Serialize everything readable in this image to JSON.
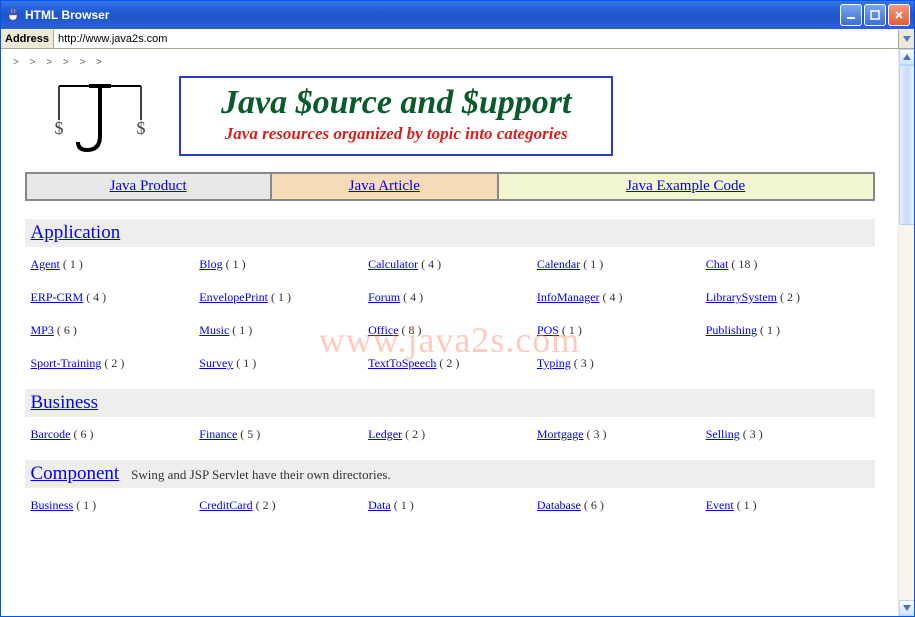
{
  "window": {
    "title": "HTML Browser"
  },
  "addressbar": {
    "label": "Address",
    "url": "http://www.java2s.com"
  },
  "watermark": "www.java2s.com",
  "breadcrumb": ">  >  >  >  >  >",
  "banner": {
    "title": "Java $ource and $upport",
    "subtitle": "Java resources organized by topic into categories"
  },
  "nav": [
    {
      "label": "Java Product"
    },
    {
      "label": "Java Article"
    },
    {
      "label": "Java Example Code"
    }
  ],
  "sections": [
    {
      "title": "Application",
      "note": "",
      "items": [
        {
          "label": "Agent",
          "count": 1
        },
        {
          "label": "Blog",
          "count": 1
        },
        {
          "label": "Calculator",
          "count": 4
        },
        {
          "label": "Calendar",
          "count": 1
        },
        {
          "label": "Chat",
          "count": 18
        },
        {
          "label": "ERP-CRM",
          "count": 4
        },
        {
          "label": "EnvelopePrint",
          "count": 1
        },
        {
          "label": "Forum",
          "count": 4
        },
        {
          "label": "InfoManager",
          "count": 4
        },
        {
          "label": "LibrarySystem",
          "count": 2
        },
        {
          "label": "MP3",
          "count": 6
        },
        {
          "label": "Music",
          "count": 1
        },
        {
          "label": "Office",
          "count": 8
        },
        {
          "label": "POS",
          "count": 1
        },
        {
          "label": "Publishing",
          "count": 1
        },
        {
          "label": "Sport-Training",
          "count": 2
        },
        {
          "label": "Survey",
          "count": 1
        },
        {
          "label": "TextToSpeech",
          "count": 2
        },
        {
          "label": "Typing",
          "count": 3
        },
        {
          "label": "",
          "count": null
        }
      ]
    },
    {
      "title": "Business",
      "note": "",
      "items": [
        {
          "label": "Barcode",
          "count": 6
        },
        {
          "label": "Finance",
          "count": 5
        },
        {
          "label": "Ledger",
          "count": 2
        },
        {
          "label": "Mortgage",
          "count": 3
        },
        {
          "label": "Selling",
          "count": 3
        }
      ]
    },
    {
      "title": "Component",
      "note": "Swing and JSP Servlet have their own directories.",
      "items": [
        {
          "label": "Business",
          "count": 1
        },
        {
          "label": "CreditCard",
          "count": 2
        },
        {
          "label": "Data",
          "count": 1
        },
        {
          "label": "Database",
          "count": 6
        },
        {
          "label": "Event",
          "count": 1
        }
      ]
    }
  ]
}
